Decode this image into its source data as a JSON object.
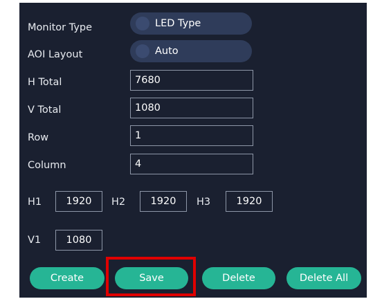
{
  "monitor_type": {
    "label": "Monitor Type",
    "value": "LED Type"
  },
  "aoi_layout": {
    "label": "AOI Layout",
    "value": "Auto"
  },
  "h_total": {
    "label": "H Total",
    "value": "7680"
  },
  "v_total": {
    "label": "V Total",
    "value": "1080"
  },
  "row": {
    "label": "Row",
    "value": "1"
  },
  "column": {
    "label": "Column",
    "value": "4"
  },
  "h_segments": [
    {
      "label": "H1",
      "value": "1920"
    },
    {
      "label": "H2",
      "value": "1920"
    },
    {
      "label": "H3",
      "value": "1920"
    }
  ],
  "v_segments": [
    {
      "label": "V1",
      "value": "1080"
    }
  ],
  "buttons": {
    "create": "Create",
    "save": "Save",
    "delete": "Delete",
    "delete_all": "Delete All"
  },
  "colors": {
    "panel_bg": "#1a2030",
    "button_accent": "#26b595",
    "pill_bg": "#2f3c5a",
    "highlight": "#e00000"
  }
}
